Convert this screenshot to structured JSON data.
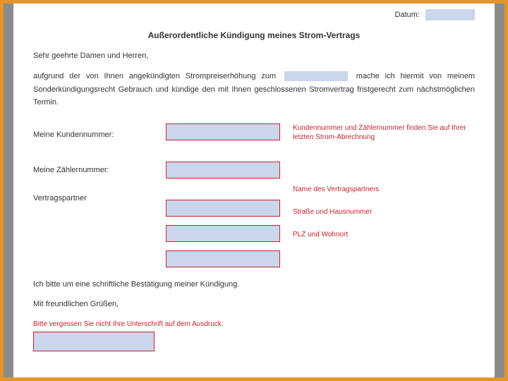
{
  "date_label": "Datum:",
  "title": "Außerordentliche Kündigung meines Strom-Vertrags",
  "salutation": "Sehr geehrte Damen und Herren,",
  "body_before": "aufgrund der von Ihnen angekündigten Strompreiserhöhung zum",
  "body_after": "mache ich hiermit von meinem Sonderkündigungsrecht Gebrauch und kündige den mit Ihnen geschlossenen Stromvertrag fristgerecht zum nächstmöglichen Termin.",
  "labels": {
    "kundennummer": "Meine Kundennummer:",
    "zaehlernummer": "Meine Zählernummer:",
    "vertragspartner": "Vertragspartner"
  },
  "hints": {
    "top": "Kundennummer und Zählernummer finden Sie auf Ihrer letzten Strom-Abrechnung",
    "name": "Name des Vertragspartners",
    "strasse": "Straße und Hausnummer",
    "plz": "PLZ und Wohnort"
  },
  "confirmation": "Ich bitte um eine schriftliche Bestätigung meiner Kündigung.",
  "signoff": "Mit freundlichen Grüßen,",
  "signature_hint": "Bitte vergessen Sie nicht Ihre Unterschrift auf dem Ausdruck."
}
